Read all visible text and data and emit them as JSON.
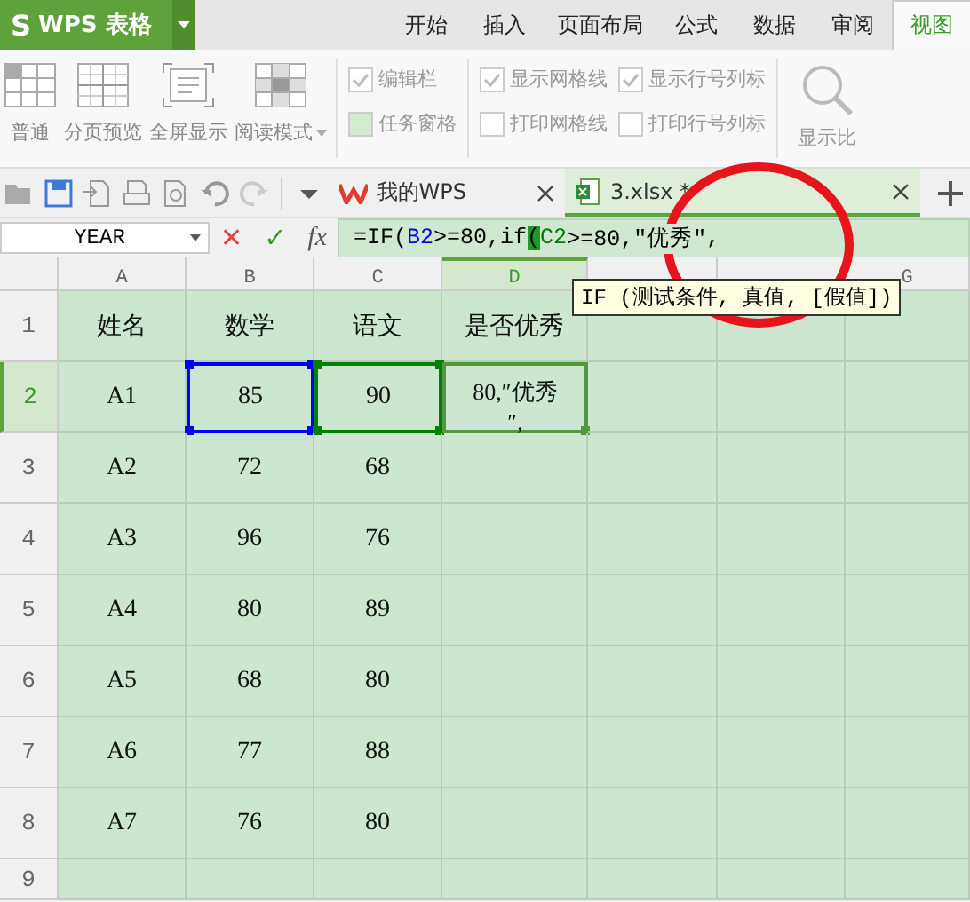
{
  "app": {
    "logo": "S",
    "title": "WPS 表格"
  },
  "menu_tabs": [
    {
      "label": "开始",
      "selected": false
    },
    {
      "label": "插入",
      "selected": false
    },
    {
      "label": "页面布局",
      "selected": false
    },
    {
      "label": "公式",
      "selected": false
    },
    {
      "label": "数据",
      "selected": false
    },
    {
      "label": "审阅",
      "selected": false
    },
    {
      "label": "视图",
      "selected": true
    }
  ],
  "ribbon": {
    "views": [
      {
        "kind": "normal",
        "label": "普通",
        "has_menu": false
      },
      {
        "kind": "page",
        "label": "分页预览",
        "has_menu": false
      },
      {
        "kind": "full",
        "label": "全屏显示",
        "has_menu": false
      },
      {
        "kind": "read",
        "label": "阅读模式",
        "has_menu": true
      }
    ],
    "options": [
      [
        {
          "label": "编辑栏",
          "checked": true
        },
        {
          "label": "任务窗格",
          "checked": false
        }
      ],
      [
        {
          "label": "显示网格线",
          "checked": true
        },
        {
          "label": "打印网格线",
          "checked": false
        }
      ],
      [
        {
          "label": "显示行号列标",
          "checked": true
        },
        {
          "label": "打印行号列标",
          "checked": false
        }
      ]
    ],
    "zoom_label": "显示比"
  },
  "doc_tabs": [
    {
      "kind": "home",
      "label": "我的WPS",
      "selected": false
    },
    {
      "kind": "sheet",
      "label": "3.xlsx *",
      "selected": true
    }
  ],
  "formula_bar": {
    "name_box": "YEAR",
    "cancel": "✕",
    "confirm": "✓",
    "fx": "fx",
    "segments": [
      {
        "text": "=IF(",
        "color": "#000000",
        "highlight": false
      },
      {
        "text": "B2",
        "color": "#0000ff",
        "highlight": false
      },
      {
        "text": ">=80,if",
        "color": "#000000",
        "highlight": false
      },
      {
        "text": "(",
        "highlight": true
      },
      {
        "text": "C2",
        "color": "#008000",
        "highlight": false
      },
      {
        "text": ">=80,″优秀″",
        "color": "#000000",
        "highlight": false
      },
      {
        "text": ",",
        "color": "#000000",
        "highlight": false
      }
    ]
  },
  "grid": {
    "columns": [
      {
        "label": "A",
        "selected": false
      },
      {
        "label": "B",
        "selected": false
      },
      {
        "label": "C",
        "selected": false
      },
      {
        "label": "D",
        "selected": true
      },
      {
        "selected": false
      },
      {
        "selected": false
      },
      {
        "label": "G",
        "selected": false
      }
    ],
    "rows": [
      {
        "header": "1",
        "selected": false,
        "cells": [
          {
            "text": "姓名"
          },
          {
            "text": "数学"
          },
          {
            "text": "语文"
          },
          {
            "text": "是否优秀"
          }
        ]
      },
      {
        "header": "2",
        "selected": true,
        "cells": [
          {
            "text": "A1"
          },
          {
            "text": "85",
            "color": "#0000ff"
          },
          {
            "text": "90",
            "color": "#008000"
          },
          {
            "lines": [
              "80,″优秀",
              "″,"
            ],
            "editing": true
          }
        ]
      },
      {
        "header": "3",
        "selected": false,
        "cells": [
          {
            "text": "A2"
          },
          {
            "text": "72"
          },
          {
            "text": "68"
          }
        ]
      },
      {
        "header": "4",
        "selected": false,
        "cells": [
          {
            "text": "A3"
          },
          {
            "text": "96"
          },
          {
            "text": "76"
          }
        ]
      },
      {
        "header": "5",
        "selected": false,
        "cells": [
          {
            "text": "A4"
          },
          {
            "text": "80"
          },
          {
            "text": "89"
          }
        ]
      },
      {
        "header": "6",
        "selected": false,
        "cells": [
          {
            "text": "A5"
          },
          {
            "text": "68"
          },
          {
            "text": "80"
          }
        ]
      },
      {
        "header": "7",
        "selected": false,
        "cells": [
          {
            "text": "A6"
          },
          {
            "text": "77"
          },
          {
            "text": "88"
          }
        ]
      },
      {
        "header": "8",
        "selected": false,
        "cells": [
          {
            "text": "A7"
          },
          {
            "text": "76"
          },
          {
            "text": "80"
          }
        ]
      },
      {
        "header": "9",
        "selected": false,
        "cells": []
      }
    ]
  },
  "tooltip": "IF (测试条件, 真值, [假值])"
}
